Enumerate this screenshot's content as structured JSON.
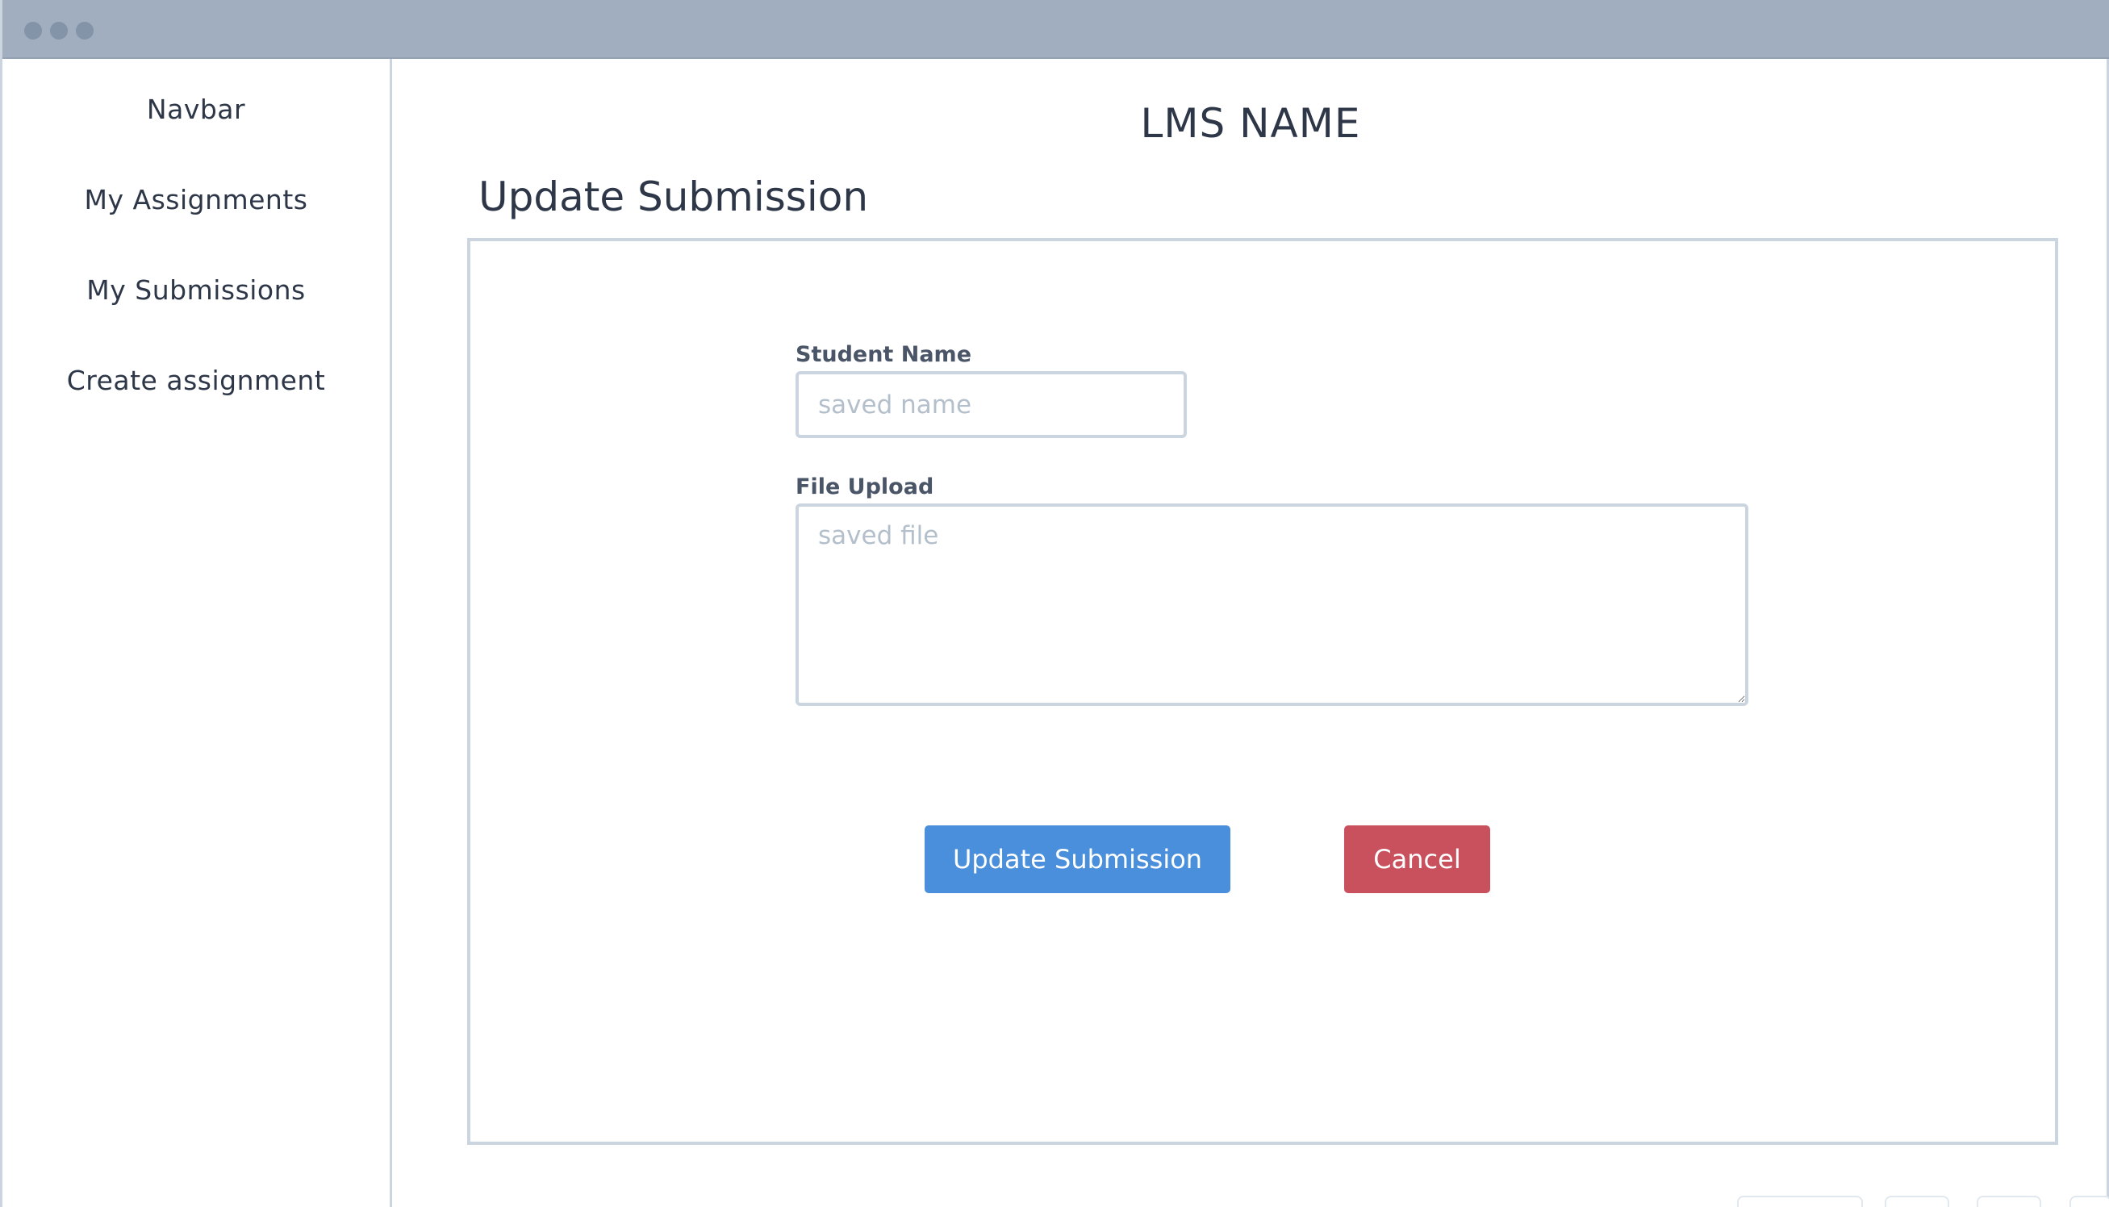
{
  "window": {
    "controls": [
      "window-dot",
      "window-dot",
      "window-dot"
    ]
  },
  "sidebar": {
    "items": [
      {
        "label": "Navbar"
      },
      {
        "label": "My Assignments"
      },
      {
        "label": "My Submissions"
      },
      {
        "label": "Create assignment"
      }
    ]
  },
  "header": {
    "title": "LMS NAME"
  },
  "main": {
    "heading": "Update Submission",
    "form": {
      "student_name": {
        "label": "Student Name",
        "placeholder": "saved name",
        "value": ""
      },
      "file_upload": {
        "label": "File Upload",
        "placeholder": "saved file",
        "value": ""
      },
      "buttons": {
        "update_label": "Update Submission",
        "cancel_label": "Cancel"
      }
    }
  },
  "colors": {
    "titlebar": "#a0aec0",
    "border": "#cbd5e0",
    "text": "#2d3748",
    "primary_button": "#4a8fdb",
    "danger_button": "#c9505d",
    "placeholder": "#b4bfcc"
  }
}
